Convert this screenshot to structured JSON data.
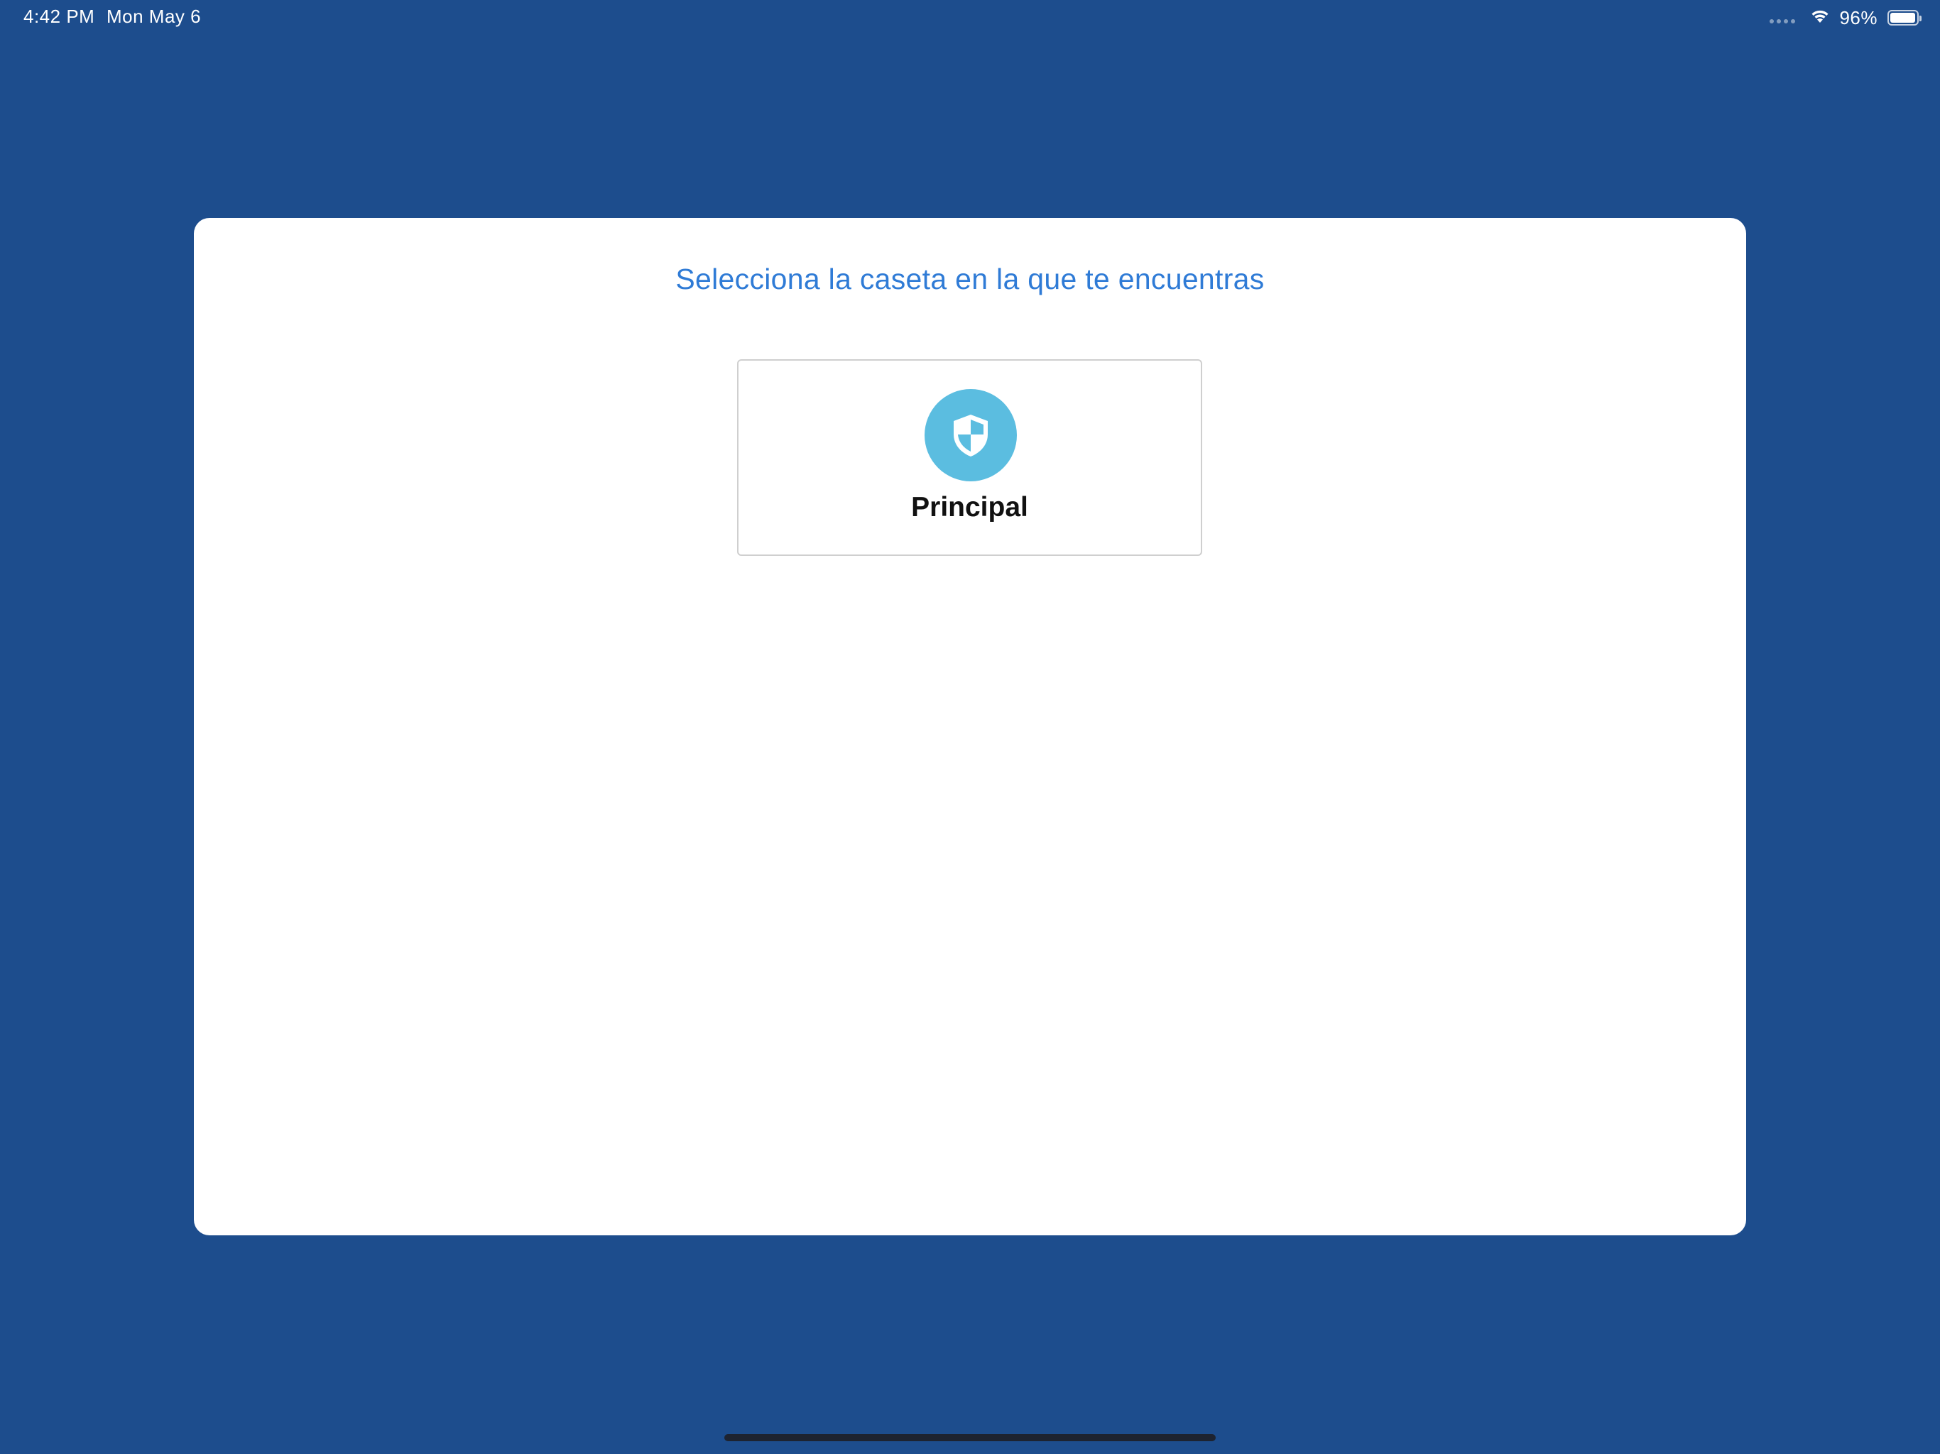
{
  "status_bar": {
    "time": "4:42 PM",
    "date": "Mon May 6",
    "battery_percent": "96%",
    "battery_level": 0.96,
    "icons": [
      "cellular-signal-icon",
      "wifi-icon",
      "battery-icon"
    ]
  },
  "card": {
    "title": "Selecciona la caseta en la que te encuentras",
    "options": [
      {
        "label": "Principal",
        "icon": "shield-icon"
      }
    ]
  },
  "colors": {
    "background": "#1d4d8d",
    "card": "#ffffff",
    "title": "#2f7bd6",
    "icon_circle": "#5bbde0",
    "option_border": "#cfcfcf",
    "home_indicator": "#1d2330"
  }
}
